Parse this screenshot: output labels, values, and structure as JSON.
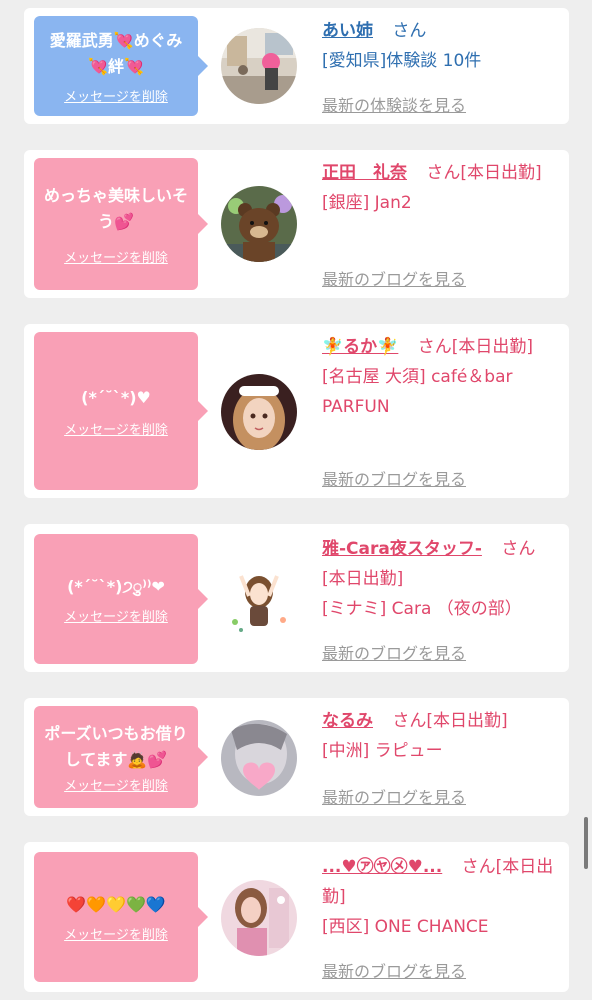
{
  "delete_label": "メッセージを削除",
  "cards": [
    {
      "message": "愛羅武勇💘めぐみ💘絆💘",
      "name": "あい姉",
      "suffix": "さん",
      "detail": "[愛知県]体験談 10件",
      "link": "最新の体験談を見る",
      "theme": "blue",
      "avatar_icon": "photo-person-pink-hair"
    },
    {
      "message": "めっちゃ美味しいそう💕",
      "name": "正田　礼奈",
      "suffix": "さん[本日出勤]",
      "detail": "[銀座] Jan2",
      "link": "最新のブログを見る",
      "theme": "pink",
      "avatar_icon": "photo-brown-bear"
    },
    {
      "message": "(*´˘`*)♥",
      "name": "🧚るか🧚",
      "suffix": "さん[本日出勤]",
      "detail": "[名古屋 大須] café＆bar PARFUN",
      "link": "最新のブログを見る",
      "theme": "pink",
      "avatar_icon": "photo-girl-maid"
    },
    {
      "message": "(*´˘`*)੭ु⁾⁾❤",
      "name": "雅-Cara夜スタッフ-",
      "suffix": "さん[本日出勤]",
      "detail": "[ミナミ] Cara （夜の部）",
      "link": "最新のブログを見る",
      "theme": "pink",
      "avatar_icon": "illustration-cheering-girl"
    },
    {
      "message": "ポーズいつもお借りしてます🙇💕",
      "name": "なるみ",
      "suffix": "さん[本日出勤]",
      "detail": "[中洲] ラピュー",
      "link": "最新のブログを見る",
      "theme": "pink",
      "avatar_icon": "photo-face-hidden-heart"
    },
    {
      "message": "❤️🧡💛💚💙",
      "name": "...♥㋐㋳㋱♥...",
      "suffix": "さん[本日出勤]",
      "detail": "[西区] ONE CHANCE",
      "link": "最新のブログを見る",
      "theme": "pink",
      "avatar_icon": "photo-girl-glamour"
    }
  ]
}
